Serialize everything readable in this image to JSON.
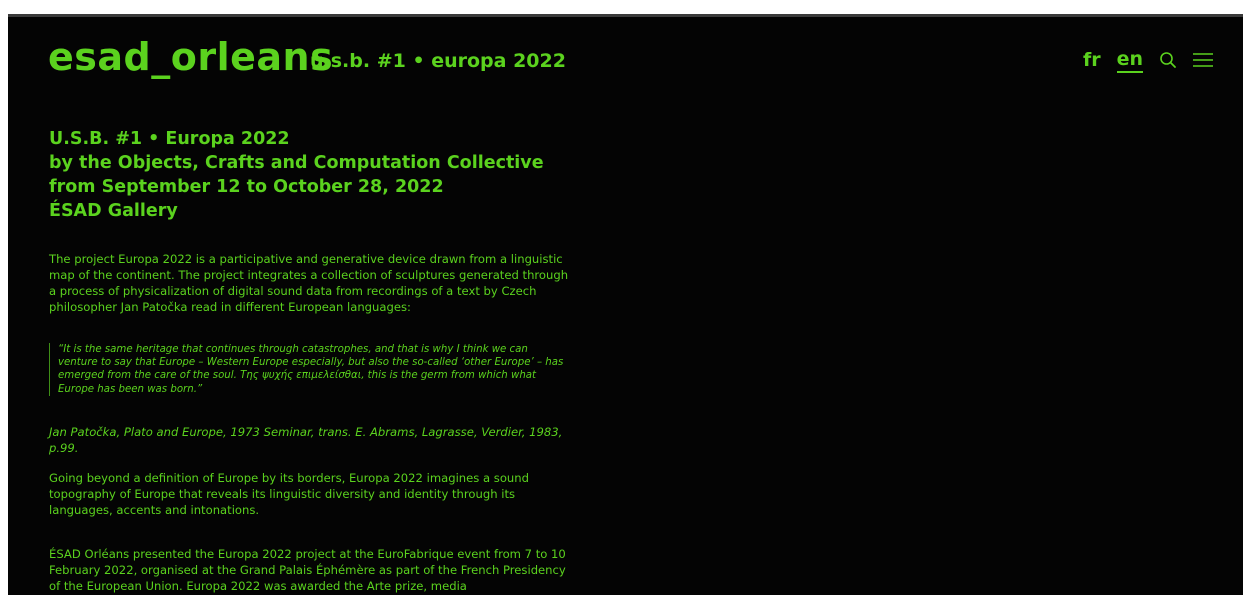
{
  "header": {
    "logo": "esad_orleans",
    "subtitle": "u.s.b. #1 • europa 2022",
    "languages": [
      {
        "label": "fr",
        "active": false
      },
      {
        "label": "en",
        "active": true
      }
    ],
    "search_icon": "search-icon",
    "menu_icon": "hamburger-menu-icon"
  },
  "main": {
    "heading_lines": [
      "U.S.B. #1 • Europa 2022",
      "by the Objects, Crafts and Computation Collective",
      "from September 12 to October 28, 2022",
      "ÉSAD Gallery"
    ],
    "paragraph1": "The project Europa 2022 is a participative and generative device drawn from a linguistic map of the continent. The project integrates a collection of sculptures generated through a process of physicalization of digital sound data from recordings of a text by Czech philosopher Jan Patočka read in different European languages:",
    "quote": "“It is the same heritage that continues through catastrophes, and that is why I think we can venture to say that Europe – Western Europe especially, but also the so-called ‘other Europe’ – has emerged from the care of the soul. Της ψυχής επιμελείσθαι, this is the germ from which what Europe has been was born.”",
    "citation": "Jan Patočka, Plato and Europe, 1973 Seminar, trans. E. Abrams, Lagrasse, Verdier, 1983, p.99.",
    "paragraph2": "Going beyond a definition of Europe by its borders, Europa 2022 imagines a sound topography of Europe that reveals its linguistic diversity and identity through its languages, accents and intonations.",
    "paragraph3": "ÉSAD Orléans presented the Europa 2022 project at the EuroFabrique event from 7 to 10 February 2022, organised at the Grand Palais Éphémère as part of the French Presidency of the European Union. Europa 2022 was awarded the Arte prize, media"
  },
  "colors": {
    "background": "#040404",
    "accent": "#5bd21e"
  }
}
